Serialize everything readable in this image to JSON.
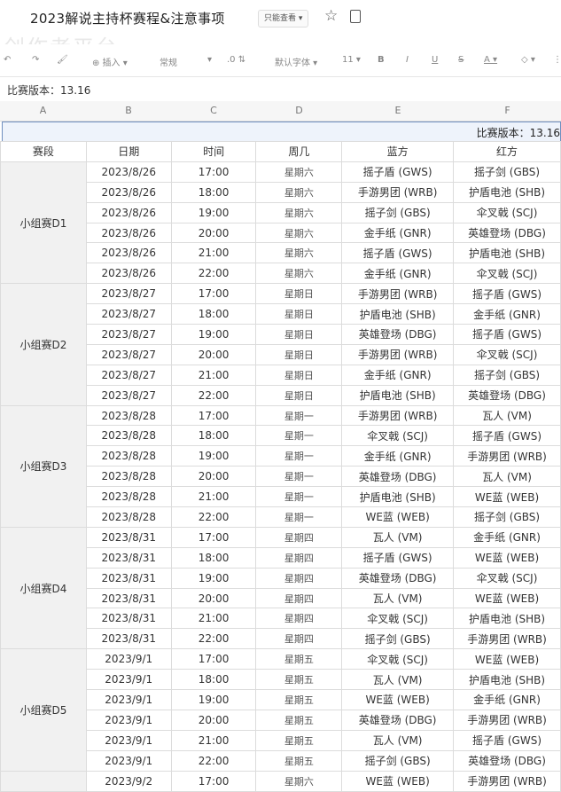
{
  "doc": {
    "title": "2023解说主持杯赛程&注意事项",
    "badge": "只能查看 ▾",
    "ghost_text": "创作者平台"
  },
  "toolbar": {
    "items": [
      "↶",
      "↷",
      "🖌",
      "⊕ 插入 ▾",
      "常规",
      "▾",
      ".0 ⇅",
      "默认字体 ▾",
      "11 ▾",
      "B",
      "I",
      "U",
      "S",
      "A ▾",
      "◇ ▾",
      "⋮"
    ]
  },
  "formula_bar": {
    "text": "比赛版本：13.16"
  },
  "columns": [
    "A",
    "B",
    "C",
    "D",
    "E",
    "F"
  ],
  "version_row": "比赛版本：13.16",
  "table": {
    "headers": [
      "赛段",
      "日期",
      "时间",
      "周几",
      "蓝方",
      "红方"
    ],
    "groups": [
      {
        "stage": "小组赛D1",
        "rows": [
          [
            "2023/8/26",
            "17:00",
            "星期六",
            "摇子盾 (GWS)",
            "摇子剑 (GBS)"
          ],
          [
            "2023/8/26",
            "18:00",
            "星期六",
            "手游男团 (WRB)",
            "护盾电池 (SHB)"
          ],
          [
            "2023/8/26",
            "19:00",
            "星期六",
            "摇子剑 (GBS)",
            "伞叉戟 (SCJ)"
          ],
          [
            "2023/8/26",
            "20:00",
            "星期六",
            "金手纸 (GNR)",
            "英雄登场 (DBG)"
          ],
          [
            "2023/8/26",
            "21:00",
            "星期六",
            "摇子盾 (GWS)",
            "护盾电池 (SHB)"
          ],
          [
            "2023/8/26",
            "22:00",
            "星期六",
            "金手纸 (GNR)",
            "伞叉戟 (SCJ)"
          ]
        ]
      },
      {
        "stage": "小组赛D2",
        "rows": [
          [
            "2023/8/27",
            "17:00",
            "星期日",
            "手游男团 (WRB)",
            "摇子盾 (GWS)"
          ],
          [
            "2023/8/27",
            "18:00",
            "星期日",
            "护盾电池 (SHB)",
            "金手纸 (GNR)"
          ],
          [
            "2023/8/27",
            "19:00",
            "星期日",
            "英雄登场 (DBG)",
            "摇子盾 (GWS)"
          ],
          [
            "2023/8/27",
            "20:00",
            "星期日",
            "手游男团 (WRB)",
            "伞叉戟 (SCJ)"
          ],
          [
            "2023/8/27",
            "21:00",
            "星期日",
            "金手纸 (GNR)",
            "摇子剑 (GBS)"
          ],
          [
            "2023/8/27",
            "22:00",
            "星期日",
            "护盾电池 (SHB)",
            "英雄登场 (DBG)"
          ]
        ]
      },
      {
        "stage": "小组赛D3",
        "rows": [
          [
            "2023/8/28",
            "17:00",
            "星期一",
            "手游男团 (WRB)",
            "瓦人 (VM)"
          ],
          [
            "2023/8/28",
            "18:00",
            "星期一",
            "伞叉戟 (SCJ)",
            "摇子盾 (GWS)"
          ],
          [
            "2023/8/28",
            "19:00",
            "星期一",
            "金手纸 (GNR)",
            "手游男团 (WRB)"
          ],
          [
            "2023/8/28",
            "20:00",
            "星期一",
            "英雄登场 (DBG)",
            "瓦人 (VM)"
          ],
          [
            "2023/8/28",
            "21:00",
            "星期一",
            "护盾电池 (SHB)",
            "WE蓝 (WEB)"
          ],
          [
            "2023/8/28",
            "22:00",
            "星期一",
            "WE蓝 (WEB)",
            "摇子剑 (GBS)"
          ]
        ]
      },
      {
        "stage": "小组赛D4",
        "rows": [
          [
            "2023/8/31",
            "17:00",
            "星期四",
            "瓦人 (VM)",
            "金手纸 (GNR)"
          ],
          [
            "2023/8/31",
            "18:00",
            "星期四",
            "摇子盾 (GWS)",
            "WE蓝 (WEB)"
          ],
          [
            "2023/8/31",
            "19:00",
            "星期四",
            "英雄登场 (DBG)",
            "伞叉戟 (SCJ)"
          ],
          [
            "2023/8/31",
            "20:00",
            "星期四",
            "瓦人 (VM)",
            "WE蓝 (WEB)"
          ],
          [
            "2023/8/31",
            "21:00",
            "星期四",
            "伞叉戟 (SCJ)",
            "护盾电池 (SHB)"
          ],
          [
            "2023/8/31",
            "22:00",
            "星期四",
            "摇子剑 (GBS)",
            "手游男团 (WRB)"
          ]
        ]
      },
      {
        "stage": "小组赛D5",
        "rows": [
          [
            "2023/9/1",
            "17:00",
            "星期五",
            "伞叉戟 (SCJ)",
            "WE蓝 (WEB)"
          ],
          [
            "2023/9/1",
            "18:00",
            "星期五",
            "瓦人 (VM)",
            "护盾电池 (SHB)"
          ],
          [
            "2023/9/1",
            "19:00",
            "星期五",
            "WE蓝 (WEB)",
            "金手纸 (GNR)"
          ],
          [
            "2023/9/1",
            "20:00",
            "星期五",
            "英雄登场 (DBG)",
            "手游男团 (WRB)"
          ],
          [
            "2023/9/1",
            "21:00",
            "星期五",
            "瓦人 (VM)",
            "摇子盾 (GWS)"
          ],
          [
            "2023/9/1",
            "22:00",
            "星期五",
            "摇子剑 (GBS)",
            "英雄登场 (DBG)"
          ]
        ]
      },
      {
        "stage": "",
        "rows": [
          [
            "2023/9/2",
            "17:00",
            "星期六",
            "WE蓝 (WEB)",
            "手游男团 (WRB)"
          ]
        ]
      }
    ]
  }
}
